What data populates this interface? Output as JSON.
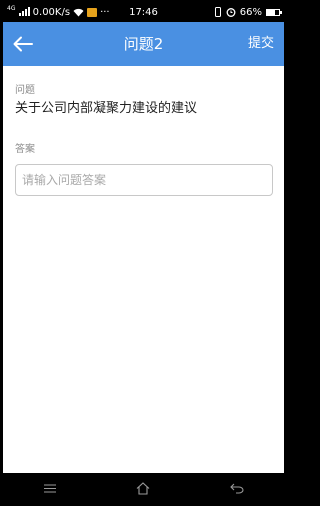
{
  "status_bar": {
    "network_type": "4G",
    "speed": "0.00K/s",
    "time": "17:46",
    "battery": "66%",
    "battery_level": 0.66,
    "more": "···"
  },
  "app_bar": {
    "title": "问题2",
    "submit_label": "提交",
    "color": "#4a90e2"
  },
  "form": {
    "question_label": "问题",
    "question_text": "关于公司内部凝聚力建设的建议",
    "answer_label": "答案",
    "answer_placeholder": "请输入问题答案",
    "answer_value": ""
  },
  "nav_bar": {
    "icons": [
      "menu-icon",
      "home-icon",
      "back-icon"
    ]
  }
}
